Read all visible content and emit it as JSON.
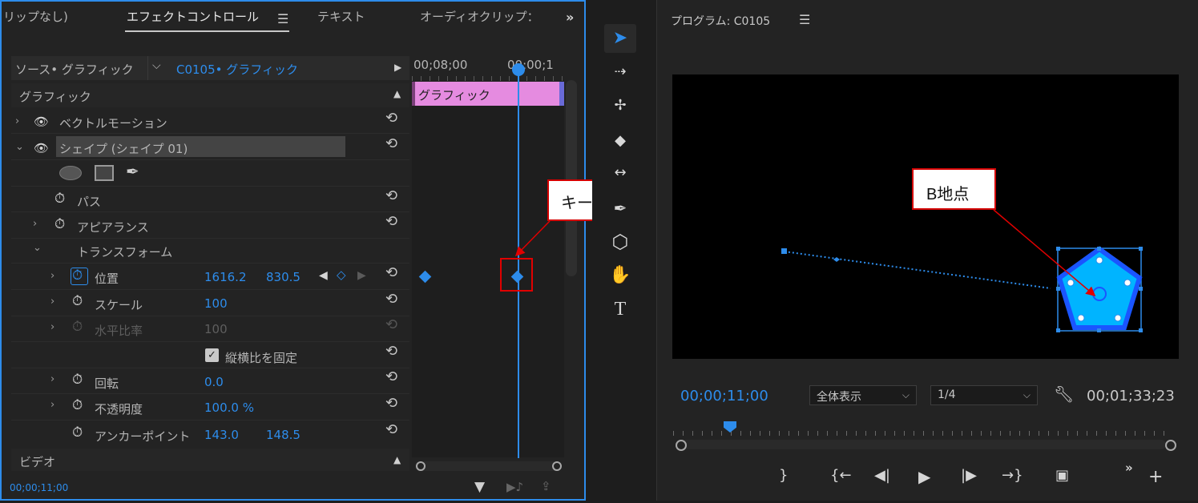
{
  "effect_panel": {
    "tabs": [
      "リップなし)",
      "エフェクトコントロール",
      "テキスト",
      "オーディオクリップ："
    ],
    "overflow": "»",
    "source_label": "ソース• グラフィック",
    "clip_label": "C0105• グラフィック",
    "timecodes": [
      "00;08;00",
      "00;00;1"
    ],
    "clip_bar_label": "グラフィック",
    "section_graphic": "グラフィック",
    "section_video": "ビデオ",
    "vector_motion": "ベクトルモーション",
    "shape_layer": "シェイプ (シェイプ 01)",
    "path": "パス",
    "appearance": "アピアランス",
    "transform": "トランスフォーム",
    "position": {
      "label": "位置",
      "x": "1616.2",
      "y": "830.5"
    },
    "scale": {
      "label": "スケール",
      "value": "100"
    },
    "scale_width": {
      "label": "水平比率",
      "value": "100"
    },
    "uniform_scale": "縦横比を固定",
    "rotation": {
      "label": "回転",
      "value": "0.0"
    },
    "opacity": {
      "label": "不透明度",
      "value": "100.0 %"
    },
    "anchor": {
      "label": "アンカーポイント",
      "x": "143.0",
      "y": "148.5"
    },
    "current_time": "00;00;11;00"
  },
  "callouts": {
    "keyframe": "キーフレーム",
    "point_b": "B地点"
  },
  "monitor": {
    "title": "プログラム: C0105",
    "timecode": "00;00;11;00",
    "fit": "全体表示",
    "resolution": "1/4",
    "duration": "00;01;33;23",
    "shape_color": "#00b4ff",
    "accent": "#2d8ceb"
  },
  "icons": [
    "selection-tool-icon",
    "track-select-icon",
    "ripple-edit-icon",
    "razor-icon",
    "slip-icon",
    "pen-icon",
    "polygon-icon",
    "hand-icon",
    "type-icon",
    "wrench-icon",
    "play-icon"
  ]
}
